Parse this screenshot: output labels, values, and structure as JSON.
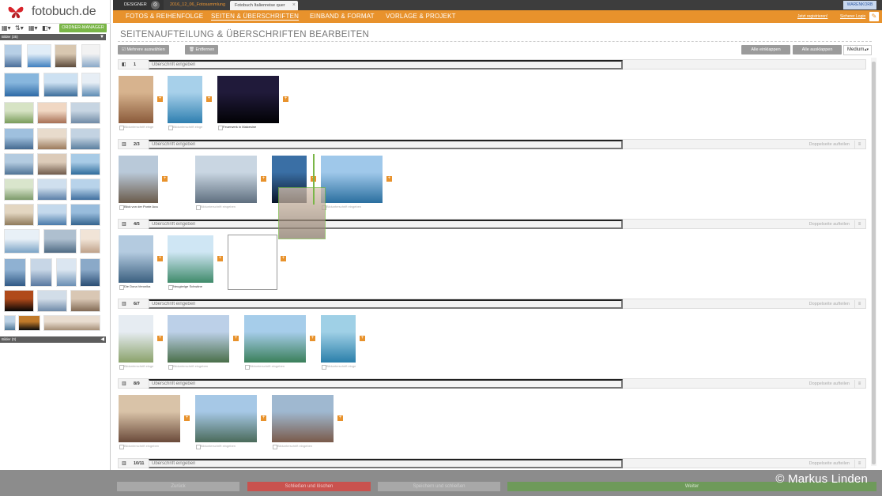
{
  "brand": {
    "logo_text": "fotobuch.de"
  },
  "sidebar": {
    "ordner_button": "ORDNER-MANAGER",
    "bar_top": "Bilder (35)",
    "bar_bottom": "Bilder (0)"
  },
  "topbar": {
    "designer": "DESIGNER",
    "tab1": "2016_12_06_Fotosammlung",
    "tab2": "Fotobuch Italienreise quer",
    "cart": "WARENKORB"
  },
  "nav": {
    "items": [
      "FOTOS & REIHENFOLGE",
      "SEITEN & ÜBERSCHRIFTEN",
      "EINBAND & FORMAT",
      "VORLAGE & PROJEKT"
    ],
    "register": "Jetzt registrieren!",
    "login": "Sicherer Login"
  },
  "main": {
    "title": "SEITENAUFTEILUNG & ÜBERSCHRIFTEN BEARBEITEN",
    "btn_select": "Mehrere auswählen",
    "btn_remove": "Entfernen",
    "btn_collapse": "Alle einklappen",
    "btn_expand": "Alle ausklappen",
    "size_select": "Medium",
    "heading_placeholder": "Überschrift eingeben",
    "split_label": "Doppelseite aufteilen",
    "caption_placeholder": "Bildunterschrift eingeben",
    "captions": [
      "Bildunterschrift eingeben",
      "Bildunterschrift eingeben",
      "Feuerwerk in Malcesine",
      "Blick von der Ponte Accademia",
      "Bildunterschrift eingeben",
      "Bildunterschrift eingeben",
      "Die Dona Veronika",
      "Neugierige Schwäne",
      "Bildunterschrift eingeben",
      "Bildunterschrift eingeben",
      "Bildunterschrift eingeben",
      "Bildunterschrift eingeben",
      "Bildunterschrift eingeben",
      "Bildunterschrift eingeben",
      "Bildunterschrift eingeben"
    ],
    "sections": [
      {
        "pages": "1"
      },
      {
        "pages": "2/3"
      },
      {
        "pages": "4/5"
      },
      {
        "pages": "6/7"
      },
      {
        "pages": "8/9"
      },
      {
        "pages": "10/11"
      }
    ]
  },
  "bottom": {
    "back": "Zurück",
    "close": "Schließen und löschen",
    "save": "Speichern und schließen",
    "next": "Weiter",
    "copyright": "© Markus Linden"
  },
  "colors": {
    "accent": "#e8922c",
    "green": "#7ab648",
    "red": "#d9534f"
  }
}
